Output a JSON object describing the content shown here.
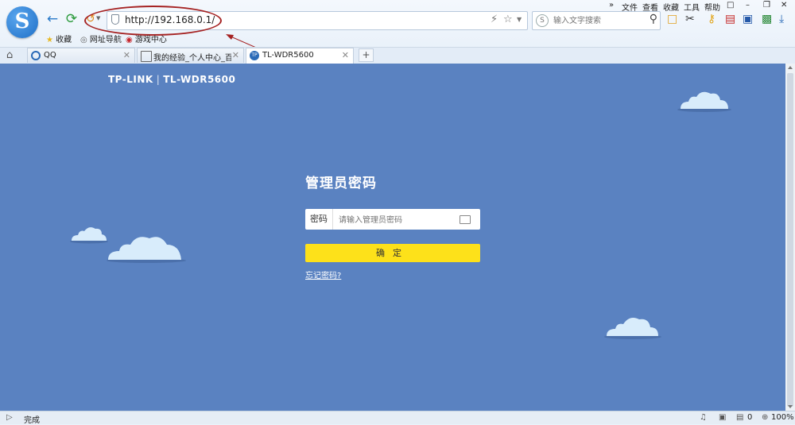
{
  "browser": {
    "logo": "S",
    "address": "http://192.168.0.1/",
    "search_placeholder": "输入文字搜索",
    "menu": [
      "»",
      "文件",
      "查看",
      "收藏",
      "工具",
      "帮助"
    ],
    "bookmarks": [
      {
        "icon": "star-icon",
        "label": "收藏"
      },
      {
        "icon": "globe-icon",
        "label": "网址导航"
      },
      {
        "icon": "game-icon",
        "label": "游戏中心"
      }
    ],
    "tabs": [
      {
        "label": "QQ"
      },
      {
        "label": "我的经验_个人中心_百度"
      },
      {
        "label": "TL-WDR5600",
        "favicon": "TP"
      }
    ],
    "new_tab": "+"
  },
  "router": {
    "brand": "TP-LINK",
    "model": "TL-WDR5600",
    "title": "管理员密码",
    "password_label": "密码",
    "password_placeholder": "请输入管理员密码",
    "confirm": "确定",
    "forgot": "忘记密码?"
  },
  "status": {
    "text": "完成",
    "count": "0",
    "zoom": "100%"
  },
  "colors": {
    "page_bg": "#5a82c1",
    "button": "#fde11a",
    "annotation": "#a52222"
  }
}
